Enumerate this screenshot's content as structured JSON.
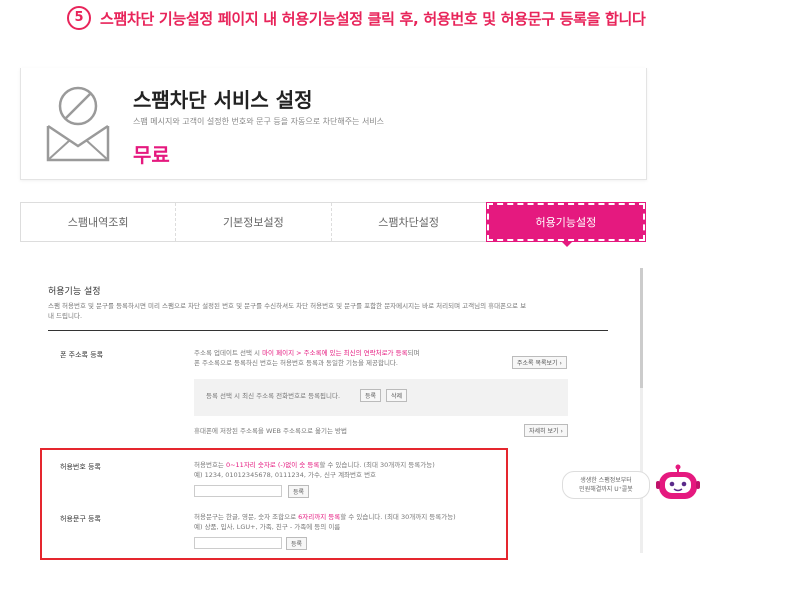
{
  "step": {
    "number": "5",
    "instruction": "스팸차단 기능설정 페이지 내 허용기능설정 클릭 후, 허용번호 및 허용문구 등록을 합니다"
  },
  "service": {
    "icon": "envelope-blocked-icon",
    "title": "스팸차단 서비스 설정",
    "description": "스팸 메시지와 고객이 설정한 번호와 문구 등을 자동으로 차단해주는 서비스",
    "price": "무료"
  },
  "tabs": [
    {
      "label": "스팸내역조회",
      "active": false
    },
    {
      "label": "기본정보설정",
      "active": false
    },
    {
      "label": "스팸차단설정",
      "active": false
    },
    {
      "label": "허용기능설정",
      "active": true
    }
  ],
  "settings": {
    "title": "허용기능 설정",
    "description_line1": "스팸 허용번호 및 문구를 등록하시면 미리 스팸으로 차단 설정된 번호 및 문구를 수신하셔도 차단 허용번호 및 문구를 포함한 문자메시지는 바로 처리되며 고객님의 휴대폰으로 보",
    "description_line2": "내 드립니다."
  },
  "address_book": {
    "label": "폰 주소록 등록",
    "line1_pre": "주소록 업데이트 선택 시 ",
    "line1_pink": "마이 페이지 > 주소록에 있는 최신의 연락처로가 등록",
    "line1_post": "되며",
    "line2": "폰 주소록으로 등록하신 번호는 허용번호 등록과 동일한 기능을 제공합니다.",
    "button": "주소록 목록보기",
    "gray_text": "등록 선택 시 최신 주소록 전화번호로 등록됩니다.",
    "register_btn": "등록",
    "delete_btn": "삭제",
    "web_text": "휴대폰에 저장된 주소록을 WEB 주소록으로 옮기는 방법",
    "web_btn": "자세히 보기"
  },
  "allowed_number": {
    "label": "허용번호 등록",
    "text_pre": "허용번호는 ",
    "text_pink": "0~11자리 숫자로 (-)없이 숫 등록",
    "text_post": "할 수 있습니다. (최대 30개까지 등록가능)",
    "example": "예) 1234, 01012345678, 0111234, 가수, 신구 계좌번호 번호",
    "button": "등록"
  },
  "allowed_phrase": {
    "label": "허용문구 등록",
    "text_pre": "허용문구는 한글, 영문, 숫자 조합으로 ",
    "text_pink": "6자리까지 등록",
    "text_post": "할 수 있습니다. (최대 30개까지 등록가능)",
    "example": "예) 상품, 입사, LGU+, 가족, 친구 - 가족에 등의 이름",
    "button": "등록"
  },
  "helper": {
    "line1": "생생한 스팸정보부터",
    "line2": "민원해결까지 U⁺콜봇",
    "icon": "robot-icon"
  },
  "colors": {
    "accent": "#e8245a",
    "brand_pink": "#e5197f",
    "highlight_red": "#e5262e"
  }
}
